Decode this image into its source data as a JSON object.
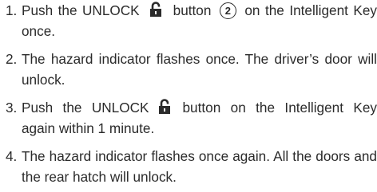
{
  "steps": [
    {
      "number": "1.",
      "line1_before": "Push the UNLOCK",
      "icon": "unlock-padlock-icon",
      "line1_after": "button",
      "callout": "2",
      "line1_end": "on the",
      "line2": "Intelligent Key once."
    },
    {
      "number": "2.",
      "text": "The hazard indicator flashes once. The driver’s door will unlock."
    },
    {
      "number": "3.",
      "line1_before": "Push the UNLOCK",
      "icon": "unlock-padlock-icon",
      "line1_after": "button on the Intelligent Key again within 1 minute."
    },
    {
      "number": "4.",
      "text": "The hazard indicator flashes once again. All the doors and the rear hatch will unlock."
    }
  ],
  "colors": {
    "text": "#2b2b2b",
    "icon": "#2b2b2b"
  }
}
